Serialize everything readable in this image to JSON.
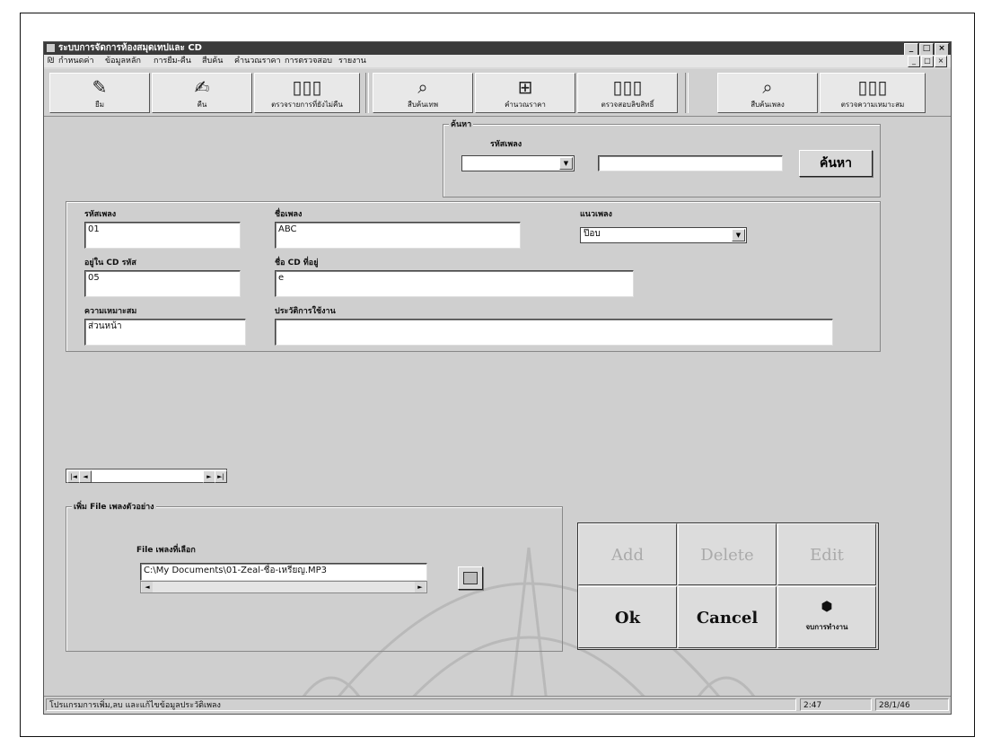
{
  "window": {
    "title": "ระบบการจัดการห้องสมุดเทปและ CD",
    "buttons": [
      "_",
      "□",
      "×"
    ]
  },
  "menubar": {
    "items": [
      "กำหนดค่า",
      "ข้อมูลหลัก",
      "การยืม-คืน",
      "สืบค้น",
      "คำนวณราคา",
      "การตรวจสอบ",
      "รายงาน"
    ],
    "mdi_buttons": [
      "_",
      "□",
      "×"
    ]
  },
  "toolbar": {
    "items": [
      {
        "label": "ยืม",
        "icon": "borrow-icon"
      },
      {
        "label": "คืน",
        "icon": "return-icon"
      },
      {
        "label": "ตรวจรายการที่ยังไม่คืน",
        "icon": "book-icon"
      },
      {
        "label": "สืบค้นเทพ",
        "icon": "search-icon"
      },
      {
        "label": "คำนวณราคา",
        "icon": "calculate-icon"
      },
      {
        "label": "ตรวจสอบลิขสิทธิ์",
        "icon": "book-icon"
      },
      {
        "label": "สืบค้นเพลง",
        "icon": "search-song-icon"
      },
      {
        "label": "ตรวจความเหมาะสม",
        "icon": "book-icon"
      }
    ]
  },
  "search": {
    "group_title": "ค้นหา",
    "field_label": "รหัสเพลง",
    "combo_value": "",
    "text_value": "",
    "button_label": "ค้นหา"
  },
  "record": {
    "song_code_label": "รหัสเพลง",
    "song_code": "01",
    "song_name_label": "ชื่อเพลง",
    "song_name": "ABC",
    "genre_label": "แนวเพลง",
    "genre": "ป๊อบ",
    "cd_code_label": "อยู่ใน CD รหัส",
    "cd_code": "05",
    "cd_name_label": "ชื่อ CD ที่อยู่",
    "cd_name": "e",
    "suitability_label": "ความเหมาะสม",
    "suitability": "ส่วนหน้า",
    "history_label": "ประวัติการใช้งาน",
    "history": ""
  },
  "navigator": {
    "first": "|◄",
    "prev": "◄",
    "next": "►",
    "last": "►|"
  },
  "sample_file": {
    "group_title": "เพิ่ม File เพลงตัวอย่าง",
    "label": "File เพลงที่เลือก",
    "path": "C:\\My Documents\\01-Zeal-ชื่อ-เหรียญ.MP3",
    "scroll_left": "◄",
    "scroll_right": "►"
  },
  "actions": {
    "add": "Add",
    "delete": "Delete",
    "edit": "Edit",
    "ok": "Ok",
    "cancel": "Cancel",
    "exit": "จบการทำงาน"
  },
  "status": {
    "message": "โปรแกรมการเพิ่ม,ลบ และแก้ไขข้อมูลประวัติเพลง",
    "time": "2:47",
    "date": "28/1/46"
  }
}
